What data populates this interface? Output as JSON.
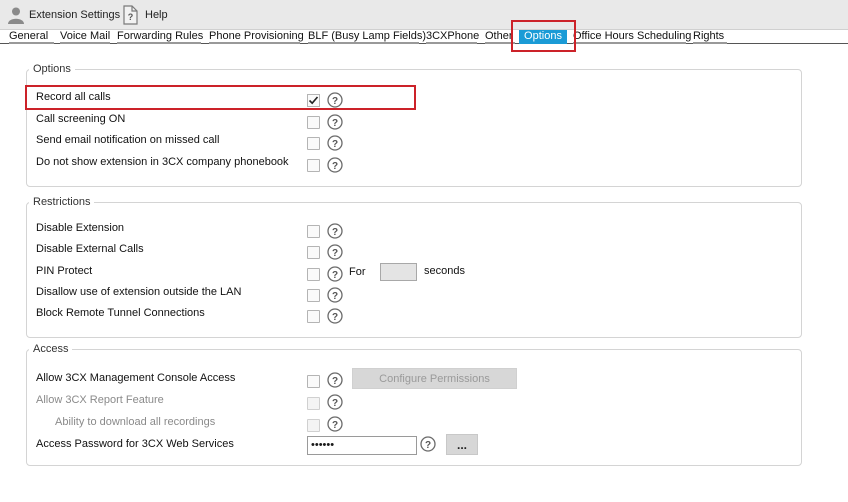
{
  "toolbar": {
    "extension_settings_label": "Extension Settings",
    "help_label": "Help"
  },
  "tabs": [
    "General",
    "Voice Mail",
    "Forwarding Rules",
    "Phone Provisioning",
    "BLF (Busy Lamp Fields)",
    "3CXPhone",
    "Other",
    "Options",
    "Office Hours Scheduling",
    "Rights"
  ],
  "active_tab": "Options",
  "options": {
    "legend": "Options",
    "record_all_calls": "Record all calls",
    "record_all_calls_checked": true,
    "call_screening": "Call screening ON",
    "email_missed_call": "Send email notification on missed call",
    "hide_in_phonebook": "Do not show extension in 3CX company phonebook"
  },
  "restrictions": {
    "legend": "Restrictions",
    "disable_extension": "Disable Extension",
    "disable_external": "Disable External Calls",
    "pin_protect": "PIN Protect",
    "pin_for": "For",
    "pin_seconds": "seconds",
    "disallow_outside_lan": "Disallow use of extension outside the LAN",
    "block_tunnel": "Block Remote Tunnel Connections"
  },
  "access": {
    "legend": "Access",
    "mgmt_console": "Allow 3CX Management Console Access",
    "configure_permissions": "Configure Permissions",
    "report_feature": "Allow 3CX Report Feature",
    "download_recordings": "Ability to download all recordings",
    "web_services_password": "Access Password for 3CX Web Services",
    "password_value": "••••••",
    "dots_button": "..."
  },
  "colors": {
    "active_tab": "#1a9bd6",
    "highlight": "#cc2229"
  }
}
